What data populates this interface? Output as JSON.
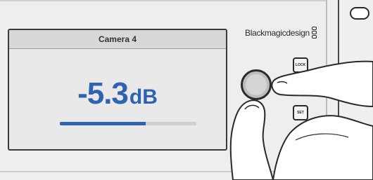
{
  "display": {
    "title": "Camera 4",
    "value": "-5.3",
    "unit": "dB",
    "level_fraction": 0.63,
    "accent_color": "#2f63b0"
  },
  "brand": {
    "name": "Blackmagicdesign",
    "logo_icon": "blackmagic-logo-icon"
  },
  "controls": {
    "lock_label": "LOCK",
    "set_label": "SET",
    "knob_icon": "rotary-knob"
  }
}
